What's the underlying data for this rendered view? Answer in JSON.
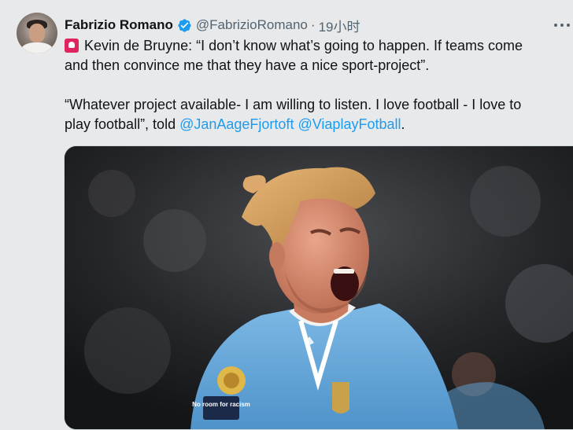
{
  "tweet": {
    "author": {
      "display_name": "Fabrizio Romano",
      "handle": "@FabrizioRomano",
      "separator": "·",
      "timestamp": "19小时",
      "verified": true,
      "verified_color": "#1d9bf0"
    },
    "text": {
      "line1_emoji": "siren-icon",
      "line1": "Kevin de Bruyne: “I don’t know what’s going to happen. If teams come",
      "line2": "and then convince me that they have a nice sport-project”.",
      "line3": "“Whatever project available- I am willing to listen. I love football - I love to",
      "line4_prefix": "play football”, told ",
      "mention1": "@JanAageFjortoft",
      "mention2": "@ViaplayFotball",
      "line4_suffix": "."
    },
    "media": {
      "kind": "photo",
      "badge_text_left": "No room for racism"
    }
  },
  "colors": {
    "background": "#e7e9ea",
    "link": "#1d9bf0",
    "secondary_text": "#536471",
    "jersey": "#6cabdd"
  }
}
